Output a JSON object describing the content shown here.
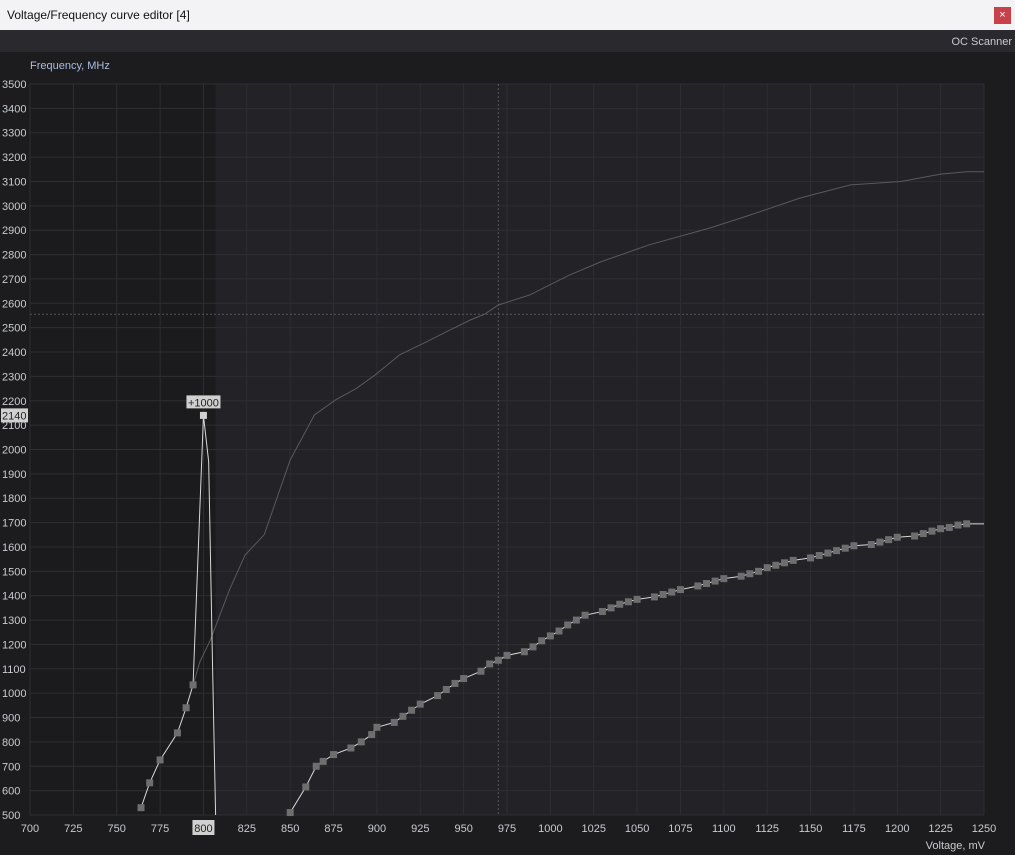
{
  "window": {
    "title": "Voltage/Frequency curve editor [4]",
    "close_label": "×"
  },
  "toolbar": {
    "oc_scanner_label": "OC Scanner"
  },
  "colors": {
    "accent_label_bg": "#d0d0d0",
    "curve": "#d8d8d8",
    "marker": "#6e6e6e",
    "reference": "#5a5a5a"
  },
  "chart_data": {
    "type": "line",
    "ylabel": "Frequency, MHz",
    "xlabel": "Voltage, mV",
    "xlim": [
      700,
      1250
    ],
    "ylim": [
      500,
      3500
    ],
    "x_ticks": [
      700,
      725,
      750,
      775,
      800,
      825,
      850,
      875,
      900,
      925,
      950,
      975,
      1000,
      1025,
      1050,
      1075,
      1100,
      1125,
      1150,
      1175,
      1200,
      1225,
      1250
    ],
    "y_ticks": [
      500,
      600,
      700,
      800,
      900,
      1000,
      1100,
      1200,
      1300,
      1400,
      1500,
      1600,
      1700,
      1800,
      1900,
      2000,
      2100,
      2200,
      2300,
      2400,
      2500,
      2600,
      2700,
      2800,
      2900,
      3000,
      3100,
      3200,
      3300,
      3400,
      3500
    ],
    "locked_region_end_mV": 807,
    "selected_point": {
      "voltage": 800,
      "frequency": 2140,
      "offset_label": "+1000",
      "x_label": "800",
      "y_label": "2140"
    },
    "crosshair": {
      "voltage": 970,
      "frequency": 2555
    },
    "series": [
      {
        "name": "edited-curve-left",
        "markers": [
          [
            764,
            530
          ],
          [
            769,
            632
          ],
          [
            775,
            726
          ],
          [
            785,
            837
          ],
          [
            790,
            940
          ],
          [
            794,
            1034
          ],
          [
            800,
            2140
          ]
        ],
        "tail": [
          [
            803,
            1950
          ],
          [
            805,
            1200
          ],
          [
            807,
            500
          ]
        ]
      },
      {
        "name": "edited-curve-right",
        "markers": [
          [
            850,
            510
          ],
          [
            859,
            615
          ],
          [
            865,
            700
          ],
          [
            869,
            720
          ],
          [
            875,
            748
          ],
          [
            885,
            775
          ],
          [
            891,
            800
          ],
          [
            897,
            830
          ],
          [
            900,
            860
          ],
          [
            910,
            880
          ],
          [
            915,
            905
          ],
          [
            920,
            930
          ],
          [
            925,
            955
          ],
          [
            935,
            990
          ],
          [
            940,
            1015
          ],
          [
            945,
            1040
          ],
          [
            950,
            1060
          ],
          [
            960,
            1090
          ],
          [
            965,
            1120
          ],
          [
            970,
            1135
          ],
          [
            975,
            1155
          ],
          [
            985,
            1170
          ],
          [
            990,
            1190
          ],
          [
            995,
            1215
          ],
          [
            1000,
            1235
          ],
          [
            1005,
            1255
          ],
          [
            1010,
            1280
          ],
          [
            1015,
            1300
          ],
          [
            1020,
            1320
          ],
          [
            1030,
            1335
          ],
          [
            1035,
            1350
          ],
          [
            1040,
            1365
          ],
          [
            1045,
            1375
          ],
          [
            1050,
            1385
          ],
          [
            1060,
            1395
          ],
          [
            1065,
            1405
          ],
          [
            1070,
            1415
          ],
          [
            1075,
            1425
          ],
          [
            1085,
            1440
          ],
          [
            1090,
            1450
          ],
          [
            1095,
            1460
          ],
          [
            1100,
            1470
          ],
          [
            1110,
            1480
          ],
          [
            1115,
            1490
          ],
          [
            1120,
            1500
          ],
          [
            1125,
            1515
          ],
          [
            1130,
            1525
          ],
          [
            1135,
            1535
          ],
          [
            1140,
            1545
          ],
          [
            1150,
            1555
          ],
          [
            1155,
            1565
          ],
          [
            1160,
            1575
          ],
          [
            1165,
            1585
          ],
          [
            1170,
            1595
          ],
          [
            1175,
            1605
          ],
          [
            1185,
            1610
          ],
          [
            1190,
            1620
          ],
          [
            1195,
            1630
          ],
          [
            1200,
            1640
          ],
          [
            1210,
            1645
          ],
          [
            1215,
            1655
          ],
          [
            1220,
            1665
          ],
          [
            1225,
            1675
          ],
          [
            1230,
            1680
          ],
          [
            1235,
            1690
          ],
          [
            1240,
            1695
          ]
        ],
        "tail": [
          [
            1250,
            1695
          ]
        ]
      },
      {
        "name": "reference-curve",
        "points": [
          [
            794,
            1034
          ],
          [
            798,
            1130
          ],
          [
            804,
            1218
          ],
          [
            815,
            1424
          ],
          [
            824,
            1567
          ],
          [
            835,
            1650
          ],
          [
            850,
            1957
          ],
          [
            864,
            2142
          ],
          [
            876,
            2203
          ],
          [
            888,
            2250
          ],
          [
            899,
            2306
          ],
          [
            913,
            2388
          ],
          [
            928,
            2440
          ],
          [
            942,
            2490
          ],
          [
            954,
            2532
          ],
          [
            962,
            2555
          ],
          [
            970,
            2593
          ],
          [
            988,
            2634
          ],
          [
            1011,
            2716
          ],
          [
            1029,
            2770
          ],
          [
            1057,
            2840
          ],
          [
            1092,
            2909
          ],
          [
            1115,
            2962
          ],
          [
            1144,
            3032
          ],
          [
            1173,
            3086
          ],
          [
            1202,
            3100
          ],
          [
            1225,
            3130
          ],
          [
            1240,
            3140
          ],
          [
            1250,
            3140
          ]
        ]
      }
    ]
  }
}
